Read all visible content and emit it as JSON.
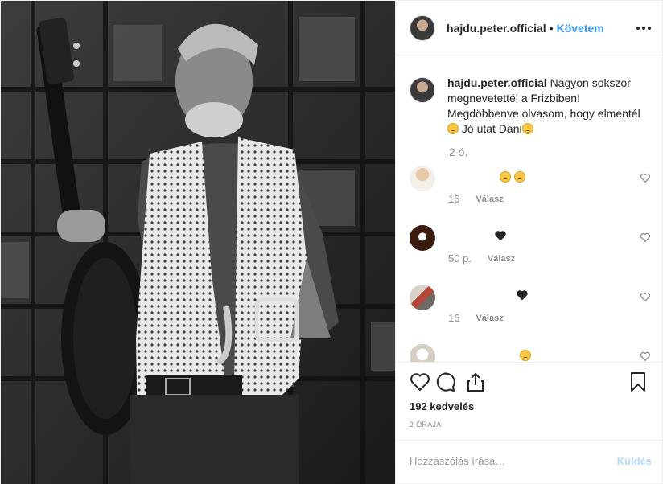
{
  "header": {
    "username": "hajdu.peter.official",
    "separator": "•",
    "follow_label": "Követem",
    "more_icon": "more-horizontal-icon"
  },
  "caption": {
    "username": "hajdu.peter.official",
    "text_part1": " Nagyon sokszor megnevetettél a Frizbiben! Megdöbbenve olvasom, hogy elmentél",
    "text_part2": " Jó utat Dani",
    "time": "2 ó."
  },
  "comments": [
    {
      "time": "16",
      "reply_label": "Válasz"
    },
    {
      "time": "50 p.",
      "reply_label": "Válasz"
    },
    {
      "time": "16",
      "reply_label": "Válasz"
    }
  ],
  "actions": {
    "likes": "192 kedvelés",
    "age": "2 ÓRÁJA"
  },
  "add_comment": {
    "placeholder": "Hozzászólás írása…",
    "post_label": "Küldés"
  },
  "colors": {
    "accent": "#3897f0",
    "muted": "#8e8e8e",
    "post_disabled": "#b3dbff"
  }
}
